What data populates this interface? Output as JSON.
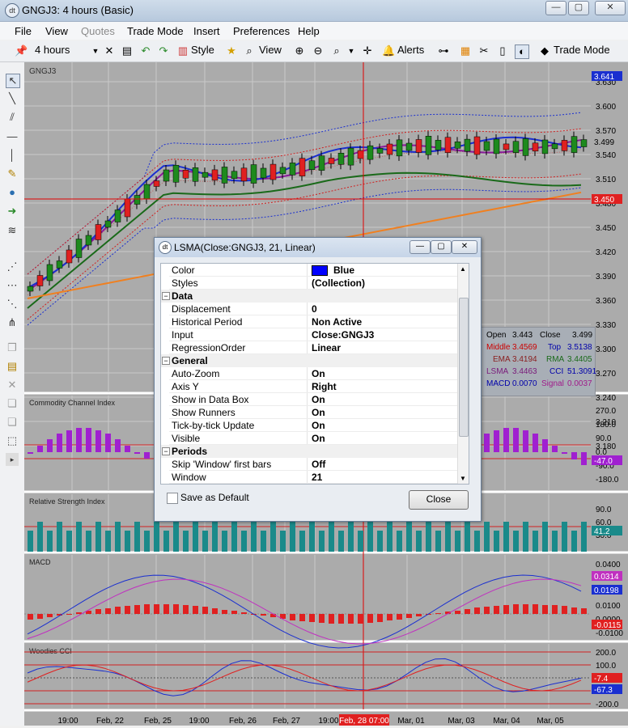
{
  "window": {
    "title": "GNGJ3: 4 hours (Basic)",
    "app_icon": "dt"
  },
  "menu": [
    "File",
    "View",
    "Quotes",
    "Trade Mode",
    "Insert",
    "Preferences",
    "Help"
  ],
  "toolbar": {
    "period": "4 hours",
    "style": "Style",
    "view": "View",
    "alerts": "Alerts",
    "trade_mode": "Trade Mode"
  },
  "chart": {
    "symbol": "GNGJ3",
    "price_ticks": [
      "3.630",
      "3.600",
      "3.570",
      "3.540",
      "3.510",
      "3.480",
      "3.450",
      "3.420",
      "3.390",
      "3.360",
      "3.330",
      "3.300",
      "3.270",
      "3.240",
      "3.210",
      "3.180"
    ],
    "price_markers": {
      "upper": "3.641",
      "close": "3.499",
      "crosshair": "3.450"
    },
    "x_labels": [
      "19:00",
      "Feb, 22",
      "Feb, 25",
      "19:00",
      "Feb, 26",
      "Feb, 27",
      "19:00",
      "Mar, 01",
      "Mar, 03",
      "Mar, 04",
      "Mar, 05"
    ],
    "crosshair_date": "Feb, 28 07:00",
    "cci": {
      "title": "Commodity Channel Index",
      "ticks": [
        "270.0",
        "180.0",
        "90.0",
        "0.0",
        "-90.0",
        "-180.0"
      ],
      "value": "-47.0"
    },
    "rsi": {
      "title": "Relative Strength Index",
      "ticks": [
        "90.0",
        "60.0",
        "30.0"
      ],
      "value": "41.2"
    },
    "macd": {
      "title": "MACD",
      "ticks": [
        "0.0400",
        "0.0300",
        "0.0200",
        "0.0100",
        "0.0000",
        "-0.0100"
      ],
      "signal_value": "0.0314",
      "macd_value": "0.0198",
      "hist_value": "-0.0115"
    },
    "woodies": {
      "title": "Woodies CCI",
      "ticks": [
        "200.0",
        "100.0",
        "0.0",
        "-100.0",
        "-200.0"
      ],
      "value1": "-7.4",
      "value2": "-67.3"
    }
  },
  "databox": {
    "open_label": "Open",
    "open": "3.443",
    "close_label": "Close",
    "close": "3.499",
    "middle_label": "Middle",
    "middle": "3.4569",
    "top_label": "Top",
    "top": "3.5138",
    "ema_label": "EMA",
    "ema": "3.4194",
    "rma_label": "RMA",
    "rma": "3.4405",
    "lsma_label": "LSMA",
    "lsma": "3.4463",
    "cci_label": "CCI",
    "cci": "51.3091",
    "macd_label": "MACD",
    "macd": "0.0070",
    "signal_label": "Signal",
    "signal": "0.0037"
  },
  "dialog": {
    "title": "LSMA(Close:GNGJ3, 21, Linear)",
    "rows": [
      {
        "name": "Color",
        "value": "Blue",
        "swatch": "#0000ff"
      },
      {
        "name": "Styles",
        "value": "(Collection)"
      },
      {
        "category": "Data"
      },
      {
        "name": "Displacement",
        "value": "0"
      },
      {
        "name": "Historical Period",
        "value": "Non Active"
      },
      {
        "name": "Input",
        "value": "Close:GNGJ3"
      },
      {
        "name": "RegressionOrder",
        "value": "Linear"
      },
      {
        "category": "General"
      },
      {
        "name": "Auto-Zoom",
        "value": "On"
      },
      {
        "name": "Axis Y",
        "value": "Right"
      },
      {
        "name": "Show in Data Box",
        "value": "On"
      },
      {
        "name": "Show Runners",
        "value": "On"
      },
      {
        "name": "Tick-by-tick Update",
        "value": "On"
      },
      {
        "name": "Visible",
        "value": "On"
      },
      {
        "category": "Periods"
      },
      {
        "name": "Skip 'Window' first bars",
        "value": "Off"
      },
      {
        "name": "Window",
        "value": "21"
      }
    ],
    "save_default": "Save as Default",
    "close": "Close"
  }
}
